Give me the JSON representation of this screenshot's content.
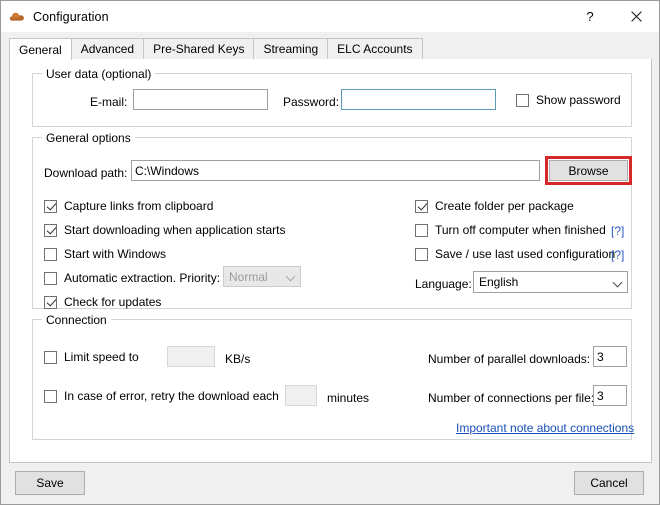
{
  "window": {
    "title": "Configuration",
    "icon": "cloud-icon",
    "help_button": "?",
    "close_button": "✕"
  },
  "tabs": [
    {
      "label": "General",
      "active": true
    },
    {
      "label": "Advanced",
      "active": false
    },
    {
      "label": "Pre-Shared Keys",
      "active": false
    },
    {
      "label": "Streaming",
      "active": false
    },
    {
      "label": "ELC Accounts",
      "active": false
    }
  ],
  "user_data": {
    "group_title": "User data (optional)",
    "email_label": "E-mail:",
    "email_value": "",
    "password_label": "Password:",
    "password_value": "",
    "show_password_label": "Show password",
    "show_password_checked": false
  },
  "general_options": {
    "group_title": "General options",
    "download_path_label": "Download path:",
    "download_path_value": "C:\\Windows",
    "browse_label": "Browse",
    "browse_highlight_color": "#d62828",
    "left_checkboxes": [
      {
        "label": "Capture links from clipboard",
        "checked": true
      },
      {
        "label": "Start downloading when application starts",
        "checked": true
      },
      {
        "label": "Start with Windows",
        "checked": false
      },
      {
        "label": "Automatic extraction. Priority:",
        "checked": false
      },
      {
        "label": "Check for updates",
        "checked": true
      }
    ],
    "priority_value": "Normal",
    "priority_disabled": true,
    "right_checkboxes": [
      {
        "label": "Create folder per package",
        "checked": true,
        "help": ""
      },
      {
        "label": "Turn off computer when finished",
        "checked": false,
        "help": "[?]"
      },
      {
        "label": "Save / use last used configuration",
        "checked": false,
        "help": "[?]"
      }
    ],
    "language_label": "Language:",
    "language_value": "English"
  },
  "connection": {
    "group_title": "Connection",
    "limit_speed_label": "Limit speed to",
    "limit_speed_checked": false,
    "limit_speed_value": "",
    "kbs_label": "KB/s",
    "retry_label": "In case of error, retry the download each",
    "retry_checked": false,
    "retry_value": "",
    "minutes_label": "minutes",
    "parallel_downloads_label": "Number of parallel downloads:",
    "parallel_downloads_value": "3",
    "connections_per_file_label": "Number of connections per file:",
    "connections_per_file_value": "3",
    "note_link": "Important note about connections"
  },
  "footer": {
    "save_label": "Save",
    "cancel_label": "Cancel"
  }
}
